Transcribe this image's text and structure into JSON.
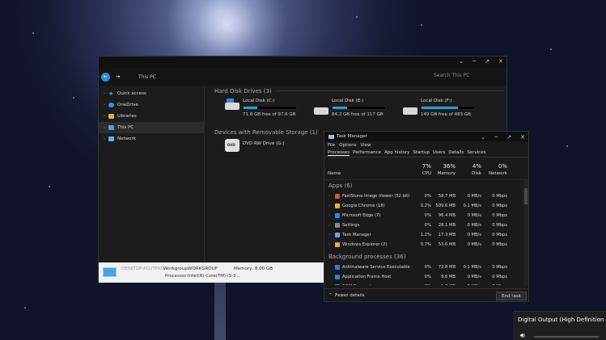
{
  "explorer": {
    "path": "This PC",
    "search_placeholder": "Search This PC",
    "sidebar": [
      {
        "label": "Quick access",
        "icon": "star-icon",
        "name": "quick-access"
      },
      {
        "label": "OneDrive",
        "icon": "cloud-icon",
        "name": "onedrive"
      },
      {
        "label": "Libraries",
        "icon": "folder-icon",
        "name": "libraries"
      },
      {
        "label": "This PC",
        "icon": "computer-icon",
        "name": "this-pc",
        "selected": true
      },
      {
        "label": "Network",
        "icon": "network-icon",
        "name": "network"
      }
    ],
    "hdd_group": "Hard Disk Drives (3)",
    "drives": [
      {
        "name": "Local Disk (C:)",
        "free": "71.8 GB free of 97.6 GB",
        "used_fraction": 0.26
      },
      {
        "name": "Local Disk (E:)",
        "free": "84.2 GB free of 117 GB",
        "used_fraction": 0.28
      },
      {
        "name": "Local Disk (F:)",
        "free": "149 GB free of 483 GB",
        "used_fraction": 0.69
      }
    ],
    "removable_group": "Devices with Removable Storage (1)",
    "dvd": {
      "name": "DVD RW Drive (G:)",
      "label": "DVD"
    },
    "details": {
      "computer_name": "DESKTOP-PO2TPKG",
      "workgroup_label": "Workgroup:",
      "workgroup_value": "WORKGROUP",
      "memory_label": "Memory:",
      "memory_value": "8.00 GB",
      "processor_label": "Processor:",
      "processor_value": "Intel(R) Core(TM) i3-3..."
    }
  },
  "taskmanager": {
    "title": "Task Manager",
    "menu": [
      "File",
      "Options",
      "View"
    ],
    "tabs": [
      "Processes",
      "Performance",
      "App history",
      "Startup",
      "Users",
      "Details",
      "Services"
    ],
    "columns": {
      "name": "Name",
      "cpu_pct": "7%",
      "cpu": "CPU",
      "mem_pct": "36%",
      "mem": "Memory",
      "disk_pct": "4%",
      "disk": "Disk",
      "net_pct": "0%",
      "net": "Network"
    },
    "apps_header": "Apps (6)",
    "apps": [
      {
        "name": "FastStone Image Viewer (32 bit)",
        "cpu": "0%",
        "mem": "58.7 MB",
        "disk": "0 MB/s",
        "net": "0 Mbps",
        "color": "#d05a2a"
      },
      {
        "name": "Google Chrome (18)",
        "cpu": "0.2%",
        "mem": "509.6 MB",
        "disk": "0.1 MB/s",
        "net": "0 Mbps",
        "color": "#e8b42a"
      },
      {
        "name": "Microsoft Edge (7)",
        "cpu": "0%",
        "mem": "96.4 MB",
        "disk": "0 MB/s",
        "net": "0 Mbps",
        "color": "#2a8ad8"
      },
      {
        "name": "Settings",
        "cpu": "0%",
        "mem": "28.1 MB",
        "disk": "0 MB/s",
        "net": "0 Mbps",
        "color": "#8a8a8a"
      },
      {
        "name": "Task Manager",
        "cpu": "1.2%",
        "mem": "17.3 MB",
        "disk": "0 MB/s",
        "net": "0 Mbps",
        "color": "#6aa6e0"
      },
      {
        "name": "Windows Explorer (2)",
        "cpu": "0.7%",
        "mem": "53.6 MB",
        "disk": "0 MB/s",
        "net": "0 Mbps",
        "color": "#d8b04a"
      }
    ],
    "bg_header": "Background processes (36)",
    "background": [
      {
        "name": "Antimalware Service Executable",
        "cpu": "0%",
        "mem": "72.8 MB",
        "disk": "0.1 MB/s",
        "net": "0 Mbps",
        "color": "#3a78c8"
      },
      {
        "name": "Application Frame Host",
        "cpu": "0%",
        "mem": "8.6 MB",
        "disk": "0 MB/s",
        "net": "0 Mbps",
        "color": "#3a78c8"
      },
      {
        "name": "COM Surrogate",
        "cpu": "0%",
        "mem": "1.3 MB",
        "disk": "0 MB/s",
        "net": "0 Mbps",
        "color": "#3a78c8"
      }
    ],
    "fewer_details": "Fewer details",
    "end_task": "End task"
  },
  "flyout": {
    "output": "Digital Output (High Definition Audio",
    "speaker_icon": "speaker-icon"
  }
}
